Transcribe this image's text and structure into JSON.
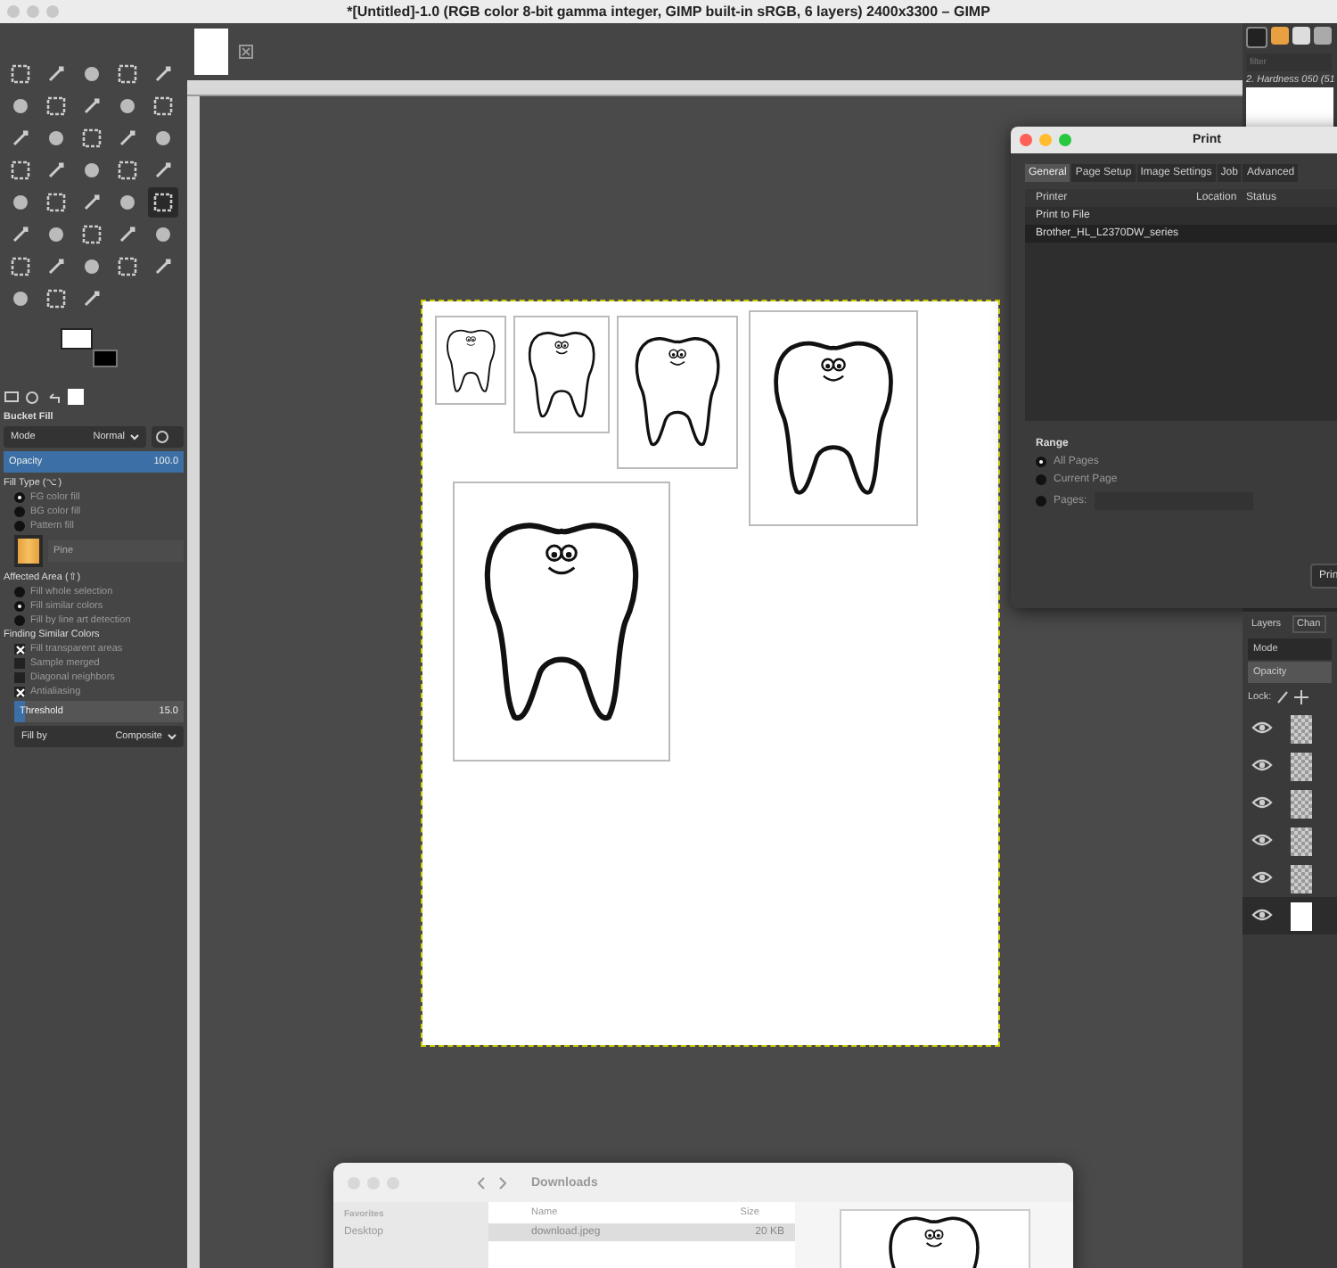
{
  "window": {
    "title": "*[Untitled]-1.0 (RGB color 8-bit gamma integer, GIMP built-in sRGB, 6 layers) 2400x3300 – GIMP"
  },
  "toolbox": {
    "tools": [
      {
        "selected": false
      },
      {
        "selected": false
      },
      {
        "selected": false
      },
      {
        "selected": false
      },
      {
        "selected": false
      },
      {
        "selected": false
      },
      {
        "selected": false
      },
      {
        "selected": false
      },
      {
        "selected": false
      },
      {
        "selected": false
      },
      {
        "selected": false
      },
      {
        "selected": false
      },
      {
        "selected": false
      },
      {
        "selected": false
      },
      {
        "selected": false
      },
      {
        "selected": false
      },
      {
        "selected": false
      },
      {
        "selected": false
      },
      {
        "selected": false
      },
      {
        "selected": false
      },
      {
        "selected": false
      },
      {
        "selected": false
      },
      {
        "selected": false
      },
      {
        "selected": false
      },
      {
        "selected": true
      },
      {
        "selected": false
      },
      {
        "selected": false
      },
      {
        "selected": false
      },
      {
        "selected": false
      },
      {
        "selected": false
      },
      {
        "selected": false
      },
      {
        "selected": false
      },
      {
        "selected": false
      },
      {
        "selected": false
      },
      {
        "selected": false
      },
      {
        "selected": false
      },
      {
        "selected": false
      },
      {
        "selected": false
      }
    ]
  },
  "tool_options": {
    "title": "Bucket Fill",
    "mode_label": "Mode",
    "mode_value": "Normal",
    "opacity_label": "Opacity",
    "opacity_value": "100.0",
    "fill_type_label": "Fill Type  (⌥)",
    "fill_types": [
      {
        "label": "FG color fill",
        "selected": true
      },
      {
        "label": "BG color fill",
        "selected": false
      },
      {
        "label": "Pattern fill",
        "selected": false
      }
    ],
    "pattern_name": "Pine",
    "affected_area_label": "Affected Area  (⇧)",
    "affected_areas": [
      {
        "label": "Fill whole selection",
        "selected": false
      },
      {
        "label": "Fill similar colors",
        "selected": true
      },
      {
        "label": "Fill by line art detection",
        "selected": false
      }
    ],
    "finding_label": "Finding Similar Colors",
    "finding_options": [
      {
        "label": "Fill transparent areas",
        "checked": true
      },
      {
        "label": "Sample merged",
        "checked": false
      },
      {
        "label": "Diagonal neighbors",
        "checked": false
      },
      {
        "label": "Antialiasing",
        "checked": true
      }
    ],
    "threshold": {
      "label": "Threshold",
      "value": "15.0",
      "level": 0.06
    },
    "fill_by_label": "Fill by",
    "fill_by_value": "Composite"
  },
  "print_dialog": {
    "title": "Print",
    "tabs": [
      {
        "label": "General",
        "selected": true
      },
      {
        "label": "Page Setup",
        "selected": false
      },
      {
        "label": "Image Settings",
        "selected": false
      },
      {
        "label": "Job",
        "selected": false
      },
      {
        "label": "Advanced",
        "selected": false
      }
    ],
    "columns": [
      "Printer",
      "Location",
      "Status"
    ],
    "printers": [
      {
        "name": "Print to File",
        "selected": false
      },
      {
        "name": "Brother_HL_L2370DW_series",
        "selected": true
      }
    ],
    "range_label": "Range",
    "ranges": [
      {
        "label": "All Pages",
        "selected": true
      },
      {
        "label": "Current Page",
        "selected": false
      },
      {
        "label": "Pages:",
        "selected": false
      }
    ],
    "print_button": "Prin"
  },
  "brushes": {
    "filter_placeholder": "filter",
    "brush_name": "2. Hardness 050 (51"
  },
  "layers": {
    "tabs": [
      {
        "label": "Layers",
        "selected": true
      },
      {
        "label": "Chan",
        "selected": false
      }
    ],
    "mode_label": "Mode",
    "opacity_label": "Opacity",
    "lock_label": "Lock:",
    "items": [
      {
        "visible": true,
        "selected": false
      },
      {
        "visible": true,
        "selected": false
      },
      {
        "visible": true,
        "selected": false
      },
      {
        "visible": true,
        "selected": false
      },
      {
        "visible": true,
        "selected": false
      },
      {
        "visible": true,
        "selected": true
      }
    ]
  },
  "finder": {
    "title": "Downloads",
    "sidebar_heading": "Favorites",
    "sidebar_items": [
      "Desktop"
    ],
    "columns": [
      "Name",
      "Size"
    ],
    "files": [
      {
        "name": "download.jpeg",
        "size": "20 KB",
        "selected": true
      }
    ]
  }
}
